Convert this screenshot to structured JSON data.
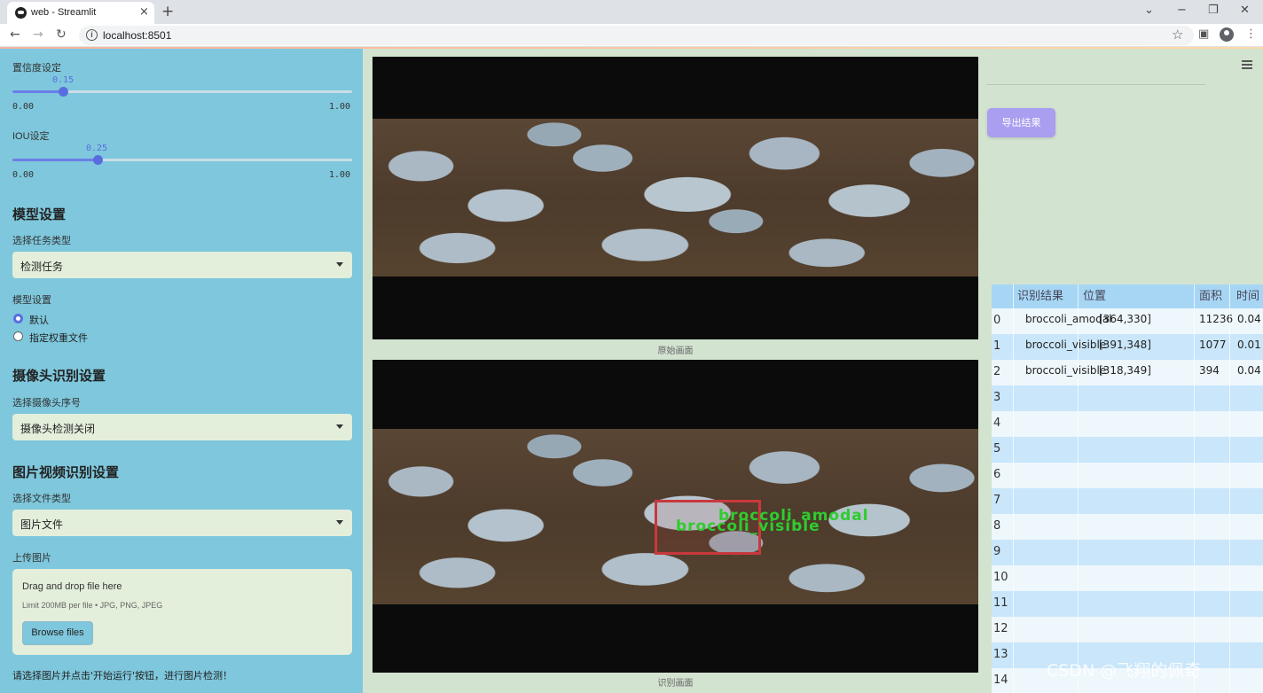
{
  "browser": {
    "tab_title": "web - Streamlit",
    "url": "localhost:8501"
  },
  "sidebar": {
    "confidence": {
      "label": "置信度设定",
      "value": "0.15",
      "min": "0.00",
      "max": "1.00",
      "fraction": 0.15
    },
    "iou": {
      "label": "IOU设定",
      "value": "0.25",
      "min": "0.00",
      "max": "1.00",
      "fraction": 0.25
    },
    "model_heading": "模型设置",
    "task_label": "选择任务类型",
    "task_value": "检测任务",
    "model_label": "模型设置",
    "model_options": [
      "默认",
      "指定权重文件"
    ],
    "model_selected": 0,
    "camera_heading": "摄像头识别设置",
    "camera_label": "选择摄像头序号",
    "camera_value": "摄像头检测关闭",
    "media_heading": "图片视频识别设置",
    "filetype_label": "选择文件类型",
    "filetype_value": "图片文件",
    "upload_label": "上传图片",
    "upload_title": "Drag and drop file here",
    "upload_sub": "Limit 200MB per file • JPG, PNG, JPEG",
    "browse_label": "Browse files",
    "hint": "请选择图片并点击'开始运行'按钮，进行图片检测！"
  },
  "main": {
    "original_caption": "原始画面",
    "result_caption": "识别画面",
    "detection_labels": [
      "broccoli_amodal",
      "broccoli_visible"
    ],
    "export_label": "导出结果"
  },
  "table": {
    "headers": [
      "识别结果",
      "位置",
      "面积",
      "时间"
    ],
    "rows": [
      {
        "idx": "0",
        "result": "broccoli_amodal",
        "pos": "[364,330]",
        "area": "11236",
        "time": "0.04"
      },
      {
        "idx": "1",
        "result": "broccoli_visible",
        "pos": "[391,348]",
        "area": "1077",
        "time": "0.01"
      },
      {
        "idx": "2",
        "result": "broccoli_visible",
        "pos": "[318,349]",
        "area": "394",
        "time": "0.04"
      },
      {
        "idx": "3"
      },
      {
        "idx": "4"
      },
      {
        "idx": "5"
      },
      {
        "idx": "6"
      },
      {
        "idx": "7"
      },
      {
        "idx": "8"
      },
      {
        "idx": "9"
      },
      {
        "idx": "10"
      },
      {
        "idx": "11"
      },
      {
        "idx": "12"
      },
      {
        "idx": "13"
      },
      {
        "idx": "14"
      }
    ]
  },
  "watermark": "CSDN @飞翔的佩奇",
  "colors": {
    "sidebar": "#7ec7dc",
    "main": "#d2e3d0",
    "accent": "#5a6de0",
    "export": "#a99ef0"
  }
}
